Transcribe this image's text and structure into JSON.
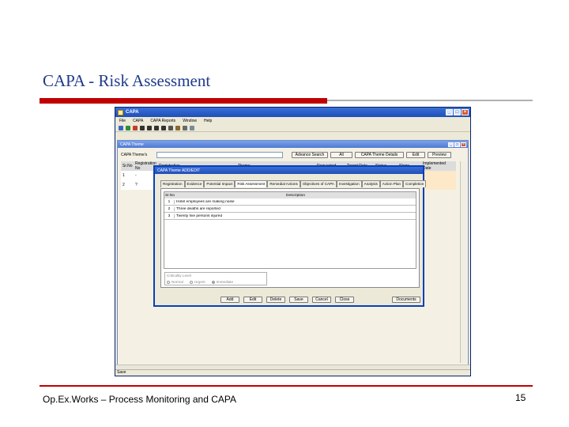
{
  "slide": {
    "title": "CAPA - Risk Assessment",
    "footer_left": "Op.Ex.Works – Process Monitoring and CAPA",
    "page_number": "15"
  },
  "app": {
    "title": "CAPA",
    "menu": [
      "File",
      "CAPA",
      "CAPA Reports",
      "Window",
      "Help"
    ],
    "toolbar_icons": [
      "save-icon",
      "add-icon",
      "delete-icon",
      "first-icon",
      "prev-icon",
      "next-icon",
      "last-icon",
      "filter-icon",
      "edit-icon",
      "copy-icon",
      "settings-icon"
    ],
    "status_text": "Save"
  },
  "capa_theme": {
    "title": "CAPA Theme",
    "search_label": "CAPA Theme's",
    "buttons": [
      "Advance Search",
      "All",
      "CAPA Theme Details",
      "Edit",
      "Preview"
    ],
    "columns": [
      "Sr.No",
      "Registration No",
      "Registration",
      "Theme",
      "Requested",
      "Target Date",
      "Status",
      "Stage",
      "Implemented Date"
    ],
    "rows": [
      {
        "sr": "1",
        "reg_no": "-"
      },
      {
        "sr": "2",
        "reg_no": "?"
      }
    ]
  },
  "dialog": {
    "title": "CAPA Theme ADD/EDIT",
    "tabs": [
      "Registration",
      "Evidence",
      "Potential Impact",
      "Risk Assessment",
      "Remedial Actions",
      "Objectives of CAPA",
      "Investigation",
      "Analysis",
      "Action Plan",
      "Completion"
    ],
    "active_tab": "Risk Assessment",
    "table_headers": [
      "Sr.No",
      "Description"
    ],
    "rows": [
      {
        "sn": "1",
        "desc": "Hotel employees are making noise"
      },
      {
        "sn": "2",
        "desc": "Three deaths are reported"
      },
      {
        "sn": "3",
        "desc": "Twenty five persons injured"
      }
    ],
    "criticality": {
      "label": "Criticality Level",
      "options": [
        "Normal",
        "Urgent",
        "Immediate"
      ],
      "selected": "Immediate"
    },
    "buttons": [
      "Add",
      "Edit",
      "Delete",
      "Save",
      "Cancel",
      "Close"
    ],
    "doc_button": "Documents"
  },
  "colors": {
    "title_blue": "#1f3a8c",
    "accent_red": "#c00000",
    "xp_blue": "#1f4fb8"
  }
}
